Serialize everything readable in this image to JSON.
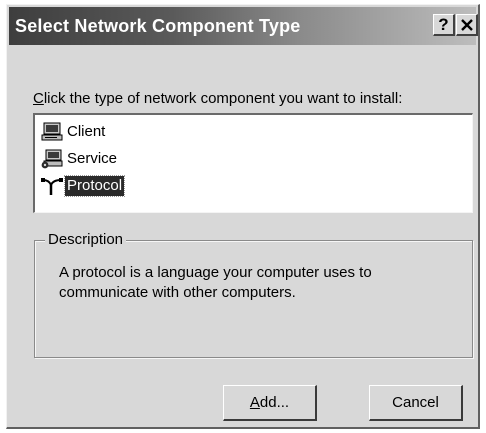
{
  "window": {
    "title": "Select Network Component Type",
    "help_label": "?",
    "close_label": "✕"
  },
  "prompt": {
    "accel": "C",
    "rest": "lick the type of network component you want to install:"
  },
  "components": [
    {
      "label": "Client",
      "icon": "client-computer-icon",
      "selected": false
    },
    {
      "label": "Service",
      "icon": "service-computer-icon",
      "selected": false
    },
    {
      "label": "Protocol",
      "icon": "protocol-cable-icon",
      "selected": true
    }
  ],
  "description": {
    "legend": "Description",
    "text": "A protocol is a language your computer uses to communicate with other computers."
  },
  "buttons": {
    "add_accel": "A",
    "add_rest": "dd...",
    "cancel": "Cancel"
  }
}
